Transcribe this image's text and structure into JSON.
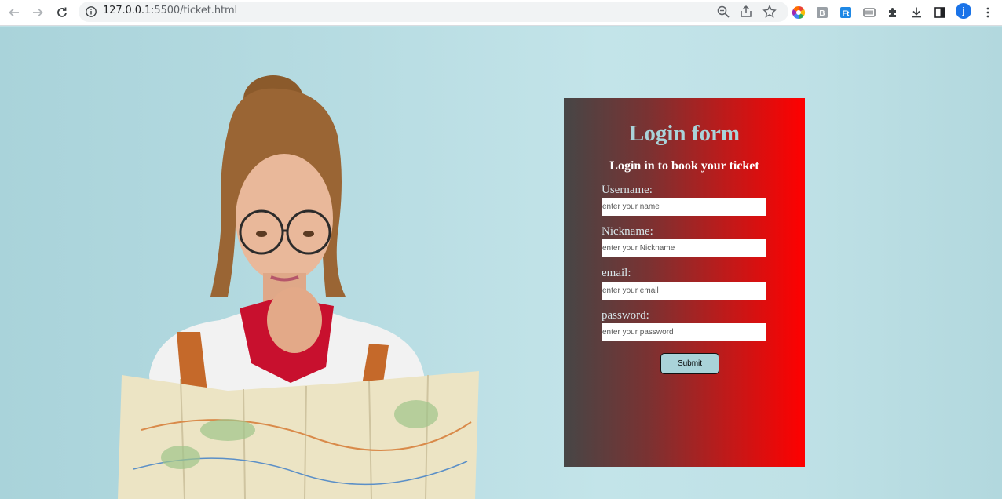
{
  "browser": {
    "url_host": "127.0.0.1",
    "url_path": ":5500/ticket.html",
    "avatar_letter": "j"
  },
  "form": {
    "title": "Login form",
    "subtitle": "Login in to book your ticket",
    "fields": [
      {
        "label": "Username:",
        "placeholder": "enter your name"
      },
      {
        "label": "Nickname:",
        "placeholder": "enter your Nickname"
      },
      {
        "label": "email:",
        "placeholder": "enter your email"
      },
      {
        "label": "password:",
        "placeholder": "enter your password"
      }
    ],
    "submit_label": "Submit"
  },
  "colors": {
    "page_background": "#bfe1e6",
    "card_gradient_start": "#464646",
    "card_gradient_end": "#ff0000",
    "title_color": "#a9d3d9",
    "button_background": "#a9d3d9"
  },
  "icons": {
    "back": "arrow-left-icon",
    "forward": "arrow-right-icon",
    "reload": "reload-icon",
    "site_info": "info-icon",
    "zoom": "zoom-icon",
    "share": "share-icon",
    "bookmark": "star-icon",
    "extensions": [
      "color-wheel-extension-icon",
      "b-extension-icon",
      "ft-extension-icon",
      "barcode-extension-icon",
      "puzzle-icon"
    ],
    "download": "download-icon",
    "side_panel": "side-panel-icon",
    "menu": "kebab-menu-icon"
  }
}
